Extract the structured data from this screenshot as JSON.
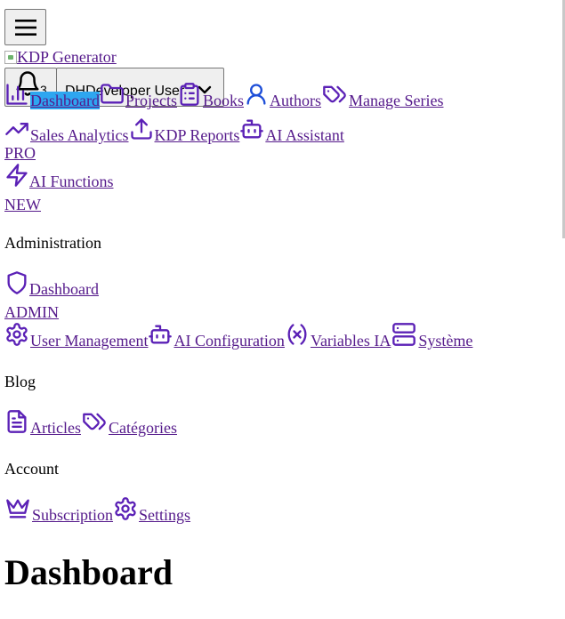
{
  "header": {
    "menu_icon": "hamburger-icon",
    "logo_alt": "KDP Generator",
    "notifications": {
      "icon": "bell-icon",
      "count": "3"
    },
    "user": {
      "name": "DHDeveloper User",
      "icon": "chevron-down-icon"
    }
  },
  "nav": {
    "main": [
      {
        "label": "Dashboard",
        "icon": "bar-chart-icon",
        "active": true
      },
      {
        "label": "Projects",
        "icon": "folder-icon"
      },
      {
        "label": "Books",
        "icon": "clipboard-list-icon"
      },
      {
        "label": "Authors",
        "icon": "user-icon"
      },
      {
        "label": "Manage Series",
        "icon": "tags-icon"
      },
      {
        "label": "Sales Analytics",
        "icon": "trending-up-icon"
      },
      {
        "label": "KDP Reports",
        "icon": "upload-icon"
      },
      {
        "label": "AI Assistant",
        "icon": "bot-icon",
        "badge": "PRO"
      },
      {
        "label": "AI Functions",
        "icon": "zap-icon",
        "badge": "NEW"
      }
    ],
    "administration": {
      "title": "Administration",
      "items": [
        {
          "label": "Dashboard",
          "icon": "shield-icon",
          "badge": "ADMIN"
        },
        {
          "label": "User Management",
          "icon": "gear-icon"
        },
        {
          "label": "AI Configuration",
          "icon": "bot-icon"
        },
        {
          "label": "Variables IA",
          "icon": "variable-icon"
        },
        {
          "label": "Système",
          "icon": "server-icon"
        }
      ]
    },
    "blog": {
      "title": "Blog",
      "items": [
        {
          "label": "Articles",
          "icon": "file-text-icon"
        },
        {
          "label": "Catégories",
          "icon": "tags-icon"
        }
      ]
    },
    "account": {
      "title": "Account",
      "items": [
        {
          "label": "Subscription",
          "icon": "crown-icon"
        },
        {
          "label": "Settings",
          "icon": "gear-icon"
        }
      ]
    }
  },
  "main": {
    "title": "Dashboard"
  },
  "colors": {
    "link": "#551a8b",
    "icon": "#5b21b6",
    "active_highlight": "#2ea6f0"
  }
}
